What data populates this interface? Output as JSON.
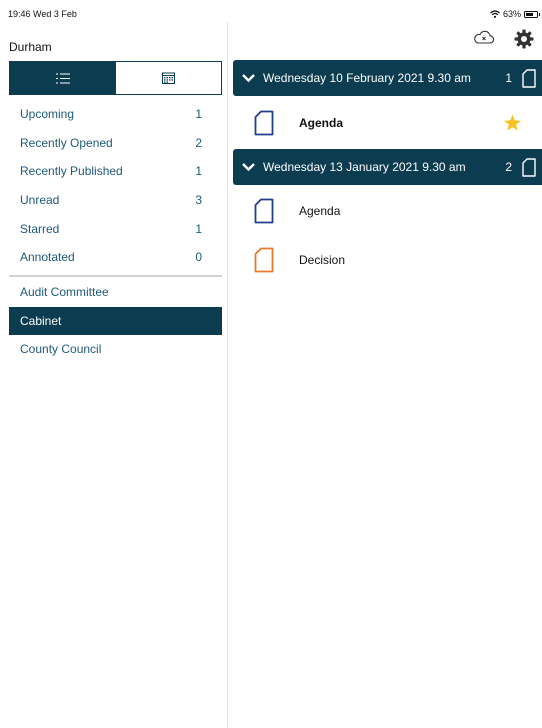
{
  "status_bar": {
    "time": "19:46  Wed 3 Feb",
    "battery": "63%"
  },
  "left": {
    "account": "Durham",
    "filters": [
      {
        "label": "Upcoming",
        "count": "1"
      },
      {
        "label": "Recently Opened",
        "count": "2"
      },
      {
        "label": "Recently Published",
        "count": "1"
      },
      {
        "label": "Unread",
        "count": "3"
      },
      {
        "label": "Starred",
        "count": "1"
      },
      {
        "label": "Annotated",
        "count": "0"
      }
    ],
    "committees": [
      {
        "label": "Audit Committee",
        "selected": false
      },
      {
        "label": "Cabinet",
        "selected": true
      },
      {
        "label": "County Council",
        "selected": false
      }
    ]
  },
  "meetings": [
    {
      "date": "Wednesday 10 February 2021 9.30 am",
      "count": "1",
      "documents": [
        {
          "title": "Agenda",
          "color": "#1f3f8a",
          "unread": true,
          "starred": true
        }
      ]
    },
    {
      "date": "Wednesday 13 January 2021 9.30 am",
      "count": "2",
      "documents": [
        {
          "title": "Agenda",
          "color": "#1f3f8a",
          "unread": false,
          "starred": false
        },
        {
          "title": "Decision",
          "color": "#e8792b",
          "unread": false,
          "starred": false
        }
      ]
    }
  ],
  "colors": {
    "primary": "#0c3c4f",
    "link": "#1d5a78",
    "star": "#f5c423"
  }
}
